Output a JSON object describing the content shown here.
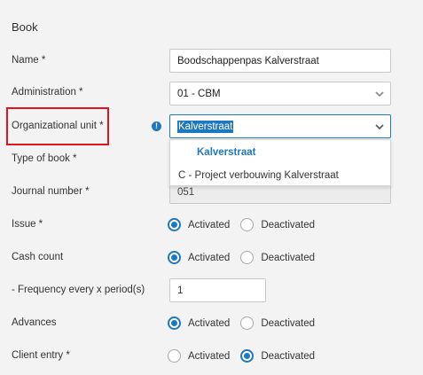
{
  "section": {
    "title": "Book"
  },
  "fields": {
    "name": {
      "label": "Name *",
      "value": "Boodschappenpas Kalverstraat"
    },
    "administration": {
      "label": "Administration *",
      "value": "01 - CBM"
    },
    "org_unit": {
      "label": "Organizational unit *",
      "value": "Kalverstraat"
    },
    "type_of_book": {
      "label": "Type of book *"
    },
    "journal_number": {
      "label": "Journal number *",
      "value": "051"
    },
    "issue": {
      "label": "Issue *",
      "selected": "Activated"
    },
    "cash_count": {
      "label": "Cash count",
      "selected": "Activated"
    },
    "frequency": {
      "label": "- Frequency every x period(s)",
      "value": "1"
    },
    "advances": {
      "label": "Advances",
      "selected": "Activated"
    },
    "client_entry": {
      "label": "Client entry *",
      "selected": "Deactivated"
    }
  },
  "dropdown": {
    "options": [
      "Kalverstraat",
      "C - Project verbouwing Kalverstraat"
    ],
    "highlighted": "Kalverstraat"
  },
  "radio_labels": {
    "on": "Activated",
    "off": "Deactivated"
  },
  "colors": {
    "accent": "#1e78be",
    "highlight_border": "#e0141e"
  }
}
